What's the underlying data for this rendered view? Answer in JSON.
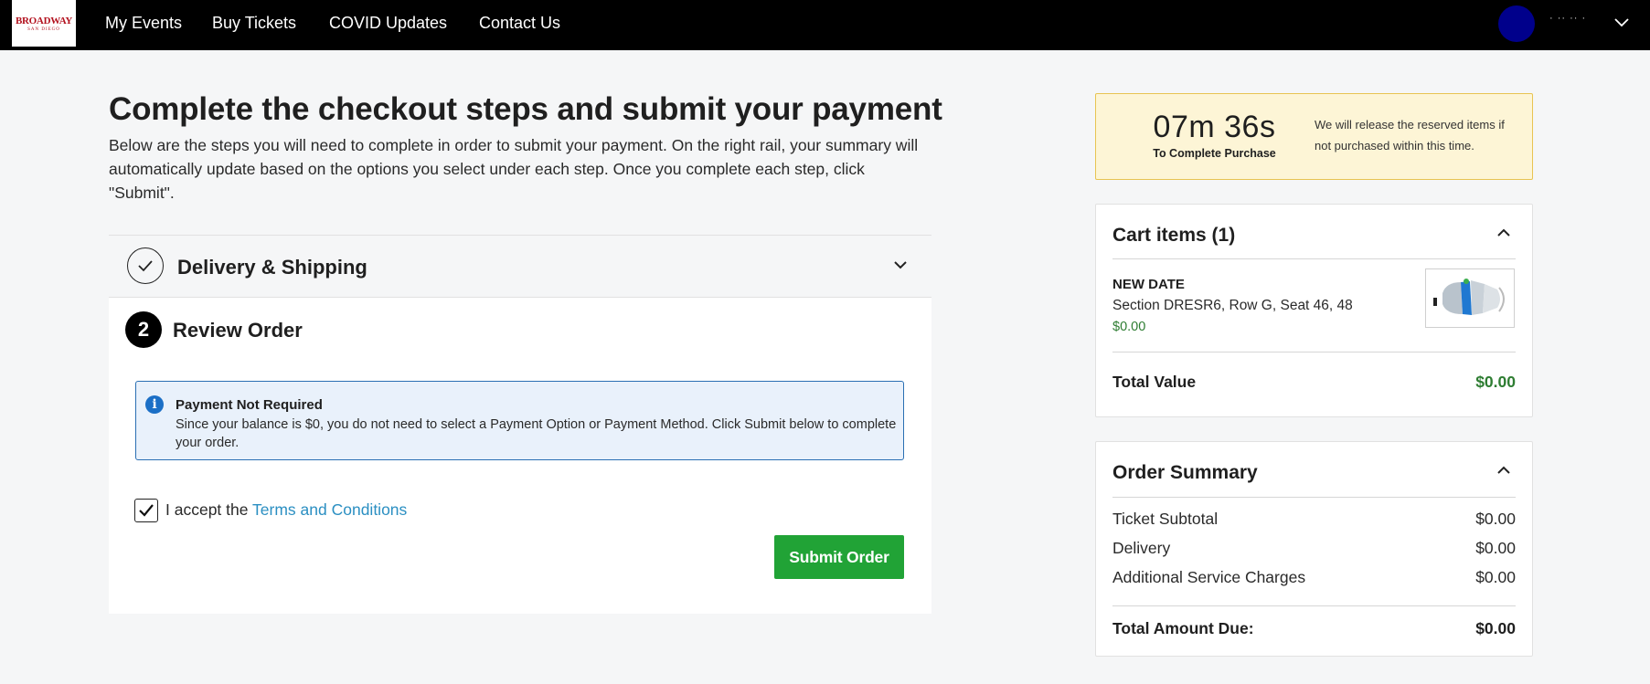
{
  "nav": {
    "logo_main": "BROADWAY",
    "logo_sub": "SAN DIEGO",
    "links": [
      "My Events",
      "Buy Tickets",
      "COVID Updates",
      "Contact Us"
    ],
    "user_name": "· ·· ·· ·"
  },
  "main": {
    "title": "Complete the checkout steps and submit your payment",
    "intro": "Below are the steps you will need to complete in order to submit your payment. On the right rail, your summary will automatically update based on the options you select under each step. Once you complete each step, click \"Submit\".",
    "step1": {
      "title": "Delivery & Shipping"
    },
    "step2": {
      "number": "2",
      "title": "Review Order",
      "info_title": "Payment Not Required",
      "info_text": "Since your balance is $0, you do not need to select a Payment Option or Payment Method. Click Submit below to complete your order.",
      "terms_prefix": "I accept the ",
      "terms_link": "Terms and Conditions",
      "terms_checked": true,
      "submit_label": "Submit Order"
    }
  },
  "timer": {
    "value": "07m 36s",
    "label": "To Complete Purchase",
    "note": "We will release the reserved items if not purchased within this time."
  },
  "cart": {
    "title": "Cart items (1)",
    "item": {
      "name": "NEW DATE",
      "seat": "Section DRESR6, Row G, Seat 46, 48",
      "price": "$0.00"
    },
    "total_label": "Total Value",
    "total_value": "$0.00"
  },
  "summary": {
    "title": "Order Summary",
    "rows": [
      {
        "label": "Ticket Subtotal",
        "value": "$0.00"
      },
      {
        "label": "Delivery",
        "value": "$0.00"
      },
      {
        "label": "Additional Service Charges",
        "value": "$0.00"
      }
    ],
    "total_label": "Total Amount Due:",
    "total_value": "$0.00"
  },
  "colors": {
    "nav_bg": "#000000",
    "accent_green": "#21a336",
    "link_blue": "#2b8fc2",
    "info_blue": "#1b6fc6",
    "timer_bg": "#fdf5d6",
    "price_green": "#2e7d32"
  },
  "icons": [
    "check-icon",
    "chevron-down-icon",
    "chevron-up-icon",
    "info-icon",
    "seat-map-thumbnail"
  ]
}
